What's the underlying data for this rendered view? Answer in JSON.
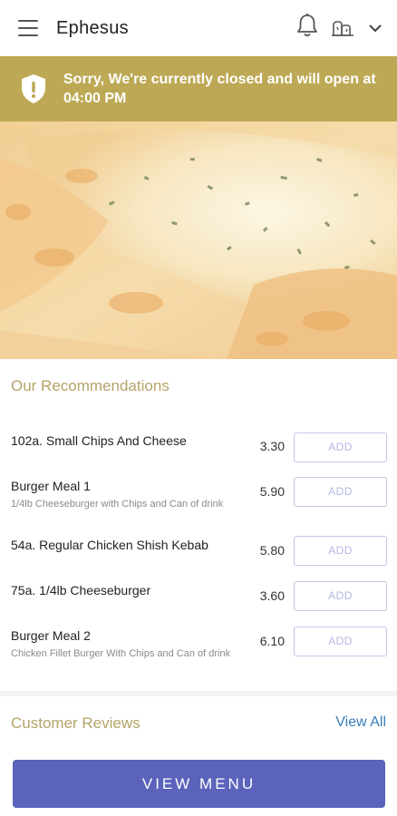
{
  "header": {
    "title": "Ephesus",
    "menu_icon": "hamburger-menu-icon",
    "notification_icon": "bell-icon",
    "language_icon": "language-flags-icon"
  },
  "banner": {
    "message": "Sorry, We're currently closed and will open at 04:00 PM",
    "icon": "shield-alert-icon",
    "color": "#bda955"
  },
  "recommendations": {
    "title": "Our Recommendations",
    "add_label": "ADD",
    "items": [
      {
        "name": "102a. Small Chips And Cheese",
        "description": "",
        "price": "3.30"
      },
      {
        "name": "Burger Meal 1",
        "description": "1/4lb Cheeseburger with Chips and Can of drink",
        "price": "5.90"
      },
      {
        "name": "54a. Regular Chicken Shish Kebab",
        "description": "",
        "price": "5.80"
      },
      {
        "name": "75a. 1/4lb Cheeseburger",
        "description": "",
        "price": "3.60"
      },
      {
        "name": "Burger Meal 2",
        "description": "Chicken Fillet Burger With Chips and Can of drink",
        "price": "6.10"
      }
    ]
  },
  "reviews": {
    "title": "Customer Reviews",
    "view_all": "View All"
  },
  "footer": {
    "view_menu": "VIEW MENU",
    "accent": "#5b63bb"
  }
}
